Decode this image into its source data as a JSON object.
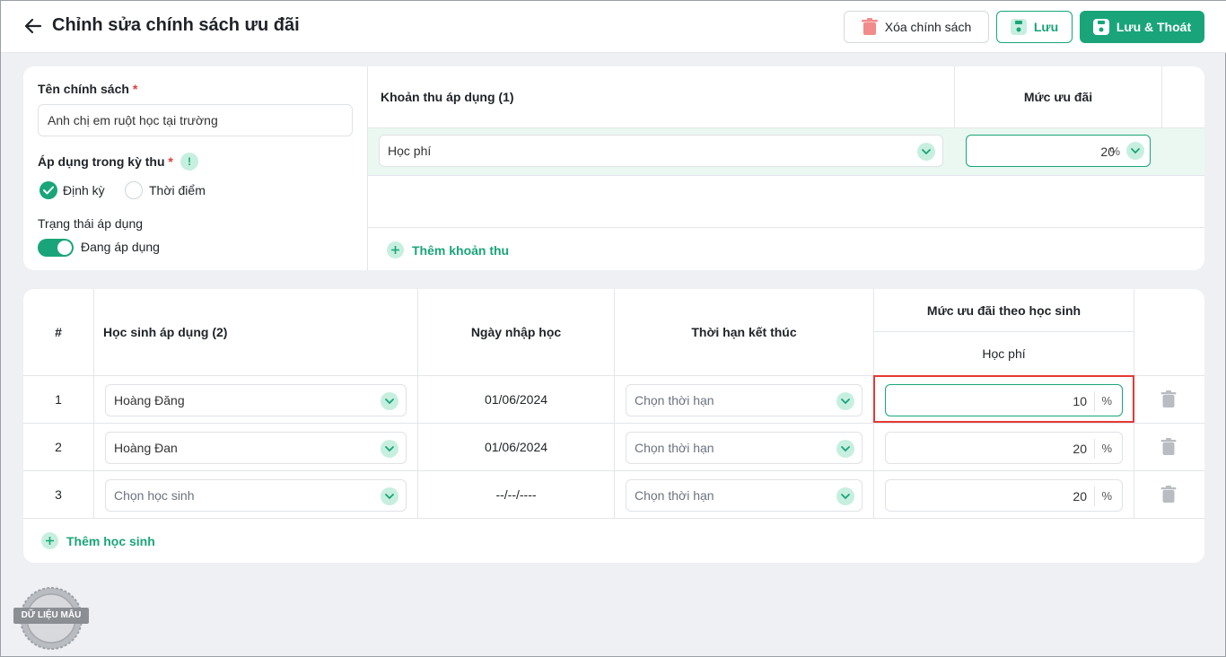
{
  "header": {
    "title": "Chỉnh sửa chính sách ưu đãi",
    "delete_label": "Xóa chính sách",
    "save_label": "Lưu",
    "save_exit_label": "Lưu & Thoát"
  },
  "policy_form": {
    "name_label": "Tên chính sách",
    "required_mark": "*",
    "name_value": "Anh chị em ruột học tại trường",
    "period_label": "Áp dụng trong kỳ thu",
    "info_mark": "!",
    "options": [
      {
        "label": "Định kỳ",
        "selected": true
      },
      {
        "label": "Thời điểm",
        "selected": false
      }
    ],
    "status_label": "Trạng thái áp dụng",
    "status_value": "Đang áp dụng",
    "status_on": true
  },
  "fee_table": {
    "col_fee": "Khoản thu áp dụng (1)",
    "col_level": "Mức ưu đãi",
    "rows": [
      {
        "fee": "Học phí",
        "value": "20",
        "unit": "%"
      }
    ],
    "add_label": "Thêm khoản thu"
  },
  "student_table": {
    "col_index": "#",
    "col_student": "Học sinh áp dụng (2)",
    "col_enroll": "Ngày nhập học",
    "col_end": "Thời hạn kết thúc",
    "col_level_group": "Mức ưu đãi theo học sinh",
    "col_level_sub": "Học phí",
    "rows": [
      {
        "index": "1",
        "student": "Hoàng Đăng",
        "enroll": "01/06/2024",
        "end": "Chọn thời hạn",
        "value": "10",
        "unit": "%"
      },
      {
        "index": "2",
        "student": "Hoàng Đan",
        "enroll": "01/06/2024",
        "end": "Chọn thời hạn",
        "value": "20",
        "unit": "%"
      },
      {
        "index": "3",
        "student": "Chọn học sinh",
        "enroll": "--/--/----",
        "end": "Chọn thời hạn",
        "value": "20",
        "unit": "%"
      }
    ],
    "add_label": "Thêm học sinh"
  },
  "stamp_label": "DỮ LIỆU MẪU",
  "colors": {
    "accent": "#19a579",
    "accent_light": "#c7efdf",
    "danger": "#e53935",
    "row_highlight": "#eaf8f1"
  }
}
